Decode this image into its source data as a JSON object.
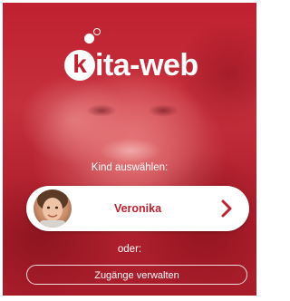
{
  "app": {
    "logo_letter": "k",
    "logo_text": "ita-web",
    "brand_color": "#c0202f"
  },
  "prompt": "Kind auswählen:",
  "children": [
    {
      "name": "Veronika",
      "avatar_icon": "child-photo",
      "action_icon": "chevron-right-icon"
    }
  ],
  "or_label": "oder:",
  "manage_button_label": "Zugänge verwalten"
}
